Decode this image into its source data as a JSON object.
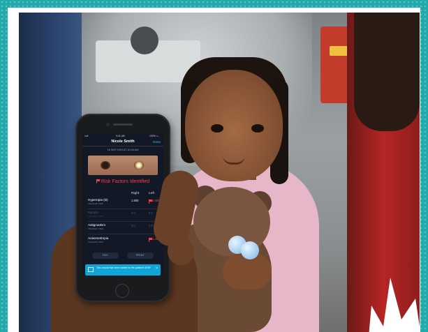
{
  "phone": {
    "status_time": "9:41 AM",
    "status_signal": "•••ll",
    "status_battery": "100% ▭",
    "nav_title": "Nicole Smith",
    "nav_done": "Done",
    "date": "16 SEP 2019 AT 10:44 AM",
    "risk_header": "Risk Factors Identified",
    "columns": {
      "right": "Right",
      "left": "Left"
    },
    "rows": [
      {
        "name": "Hyperopia (D)",
        "sub": "Threshold 1.500",
        "right": "1.500",
        "left": "2.800",
        "left_flagged": true,
        "dim": false
      },
      {
        "name": "Myopia",
        "sub": "Threshold 1.500",
        "right": "0.0",
        "left": "0.0",
        "left_flagged": false,
        "dim": true
      },
      {
        "name": "Astigmatism",
        "sub": "Threshold 1.500",
        "right": "0.0",
        "left": "0.0",
        "left_flagged": false,
        "dim": false
      },
      {
        "name": "Anisometropia",
        "sub": "Threshold 1.500",
        "right": "",
        "left": "1.400",
        "left_flagged": true,
        "dim": false
      }
    ],
    "buttons": {
      "fax": "FAX",
      "print": "PRINT"
    },
    "toast": {
      "text": "This record has been added to the patient's EHR",
      "close": "×"
    }
  },
  "colors": {
    "frame_teal": "#23a9aa",
    "screen_bg": "#121826",
    "alert_red": "#ff3b4a",
    "accent_blue": "#0fa5d6"
  }
}
